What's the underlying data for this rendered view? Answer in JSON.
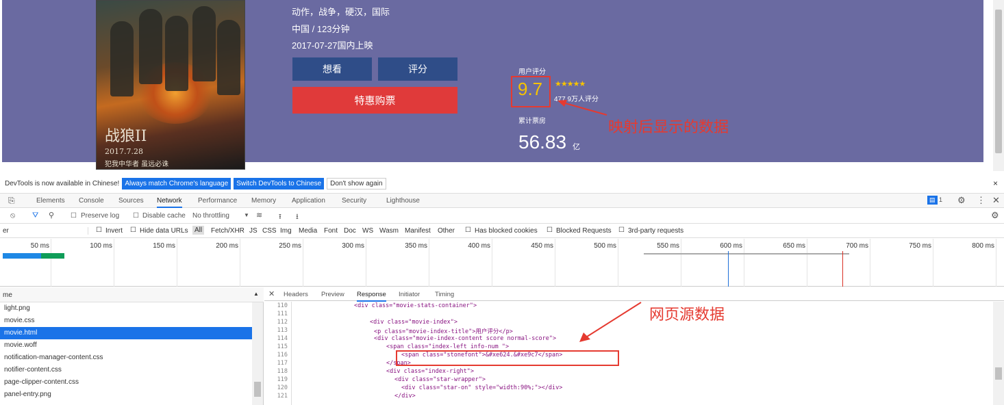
{
  "movie": {
    "genres": "动作，战争，硬汉，国际",
    "region_duration": "中国 / 123分钟",
    "release": "2017-07-27国内上映",
    "btn_want": "想看",
    "btn_rate": "评分",
    "btn_buy": "特惠购票",
    "user_score_label": "用户评分",
    "score": "9.7",
    "stars": "★★★★★",
    "rating_count": "477.9万人评分",
    "boxoffice_label": "累计票房",
    "boxoffice": "56.83",
    "boxoffice_unit": "亿",
    "poster_title": "战狼II",
    "poster_date": "2017.7.28",
    "poster_slogan": "犯我中华者 虽远必诛"
  },
  "annotations": {
    "mapped": "映射后显示的数据",
    "source": "网页源数据"
  },
  "devtools": {
    "notice": {
      "text": "DevTools is now available in Chinese!",
      "btn1": "Always match Chrome's language",
      "btn2": "Switch DevTools to Chinese",
      "btn3": "Don't show again",
      "close": "×"
    },
    "tabs": [
      "Elements",
      "Console",
      "Sources",
      "Network",
      "Performance",
      "Memory",
      "Application",
      "Security",
      "Lighthouse"
    ],
    "issues_badge": "1",
    "toolbar": {
      "preserve_log": "Preserve log",
      "disable_cache": "Disable cache",
      "throttling": "No throttling"
    },
    "filter": {
      "input_value": "er",
      "invert": "Invert",
      "hide_data_urls": "Hide data URLs",
      "types": [
        "All",
        "Fetch/XHR",
        "JS",
        "CSS",
        "Img",
        "Media",
        "Font",
        "Doc",
        "WS",
        "Wasm",
        "Manifest",
        "Other"
      ],
      "blocked_cookies": "Has blocked cookies",
      "blocked_requests": "Blocked Requests",
      "third_party": "3rd-party requests"
    },
    "timeline_ticks": [
      "50 ms",
      "100 ms",
      "150 ms",
      "200 ms",
      "250 ms",
      "300 ms",
      "350 ms",
      "400 ms",
      "450 ms",
      "500 ms",
      "550 ms",
      "600 ms",
      "650 ms",
      "700 ms",
      "750 ms",
      "800 ms"
    ],
    "file_list_header": "me",
    "files": [
      "light.png",
      "movie.css",
      "movie.html",
      "movie.woff",
      "notification-manager-content.css",
      "notifier-content.css",
      "page-clipper-content.css",
      "panel-entry.png"
    ],
    "selected_file": "movie.html",
    "response_tabs": [
      "Headers",
      "Preview",
      "Response",
      "Initiator",
      "Timing"
    ],
    "code_lines": [
      {
        "n": "110",
        "text": "<div class=\"movie-stats-container\">"
      },
      {
        "n": "111",
        "text": ""
      },
      {
        "n": "112",
        "text": "<div class=\"movie-index\">"
      },
      {
        "n": "113",
        "text": "<p class=\"movie-index-title\">用户评分</p>"
      },
      {
        "n": "114",
        "text": "<div class=\"movie-index-content score normal-score\">"
      },
      {
        "n": "115",
        "text": "<span class=\"index-left info-num \">"
      },
      {
        "n": "116",
        "text": "<span class=\"stonefont\">&#xe624.&#xe9c7</span>"
      },
      {
        "n": "117",
        "text": "</span>"
      },
      {
        "n": "118",
        "text": "<div class=\"index-right\">"
      },
      {
        "n": "119",
        "text": "<div class=\"star-wrapper\">"
      },
      {
        "n": "120",
        "text": "<div class=\"star-on\" style=\"width:90%;\"></div>"
      },
      {
        "n": "121",
        "text": "</div>"
      }
    ]
  }
}
